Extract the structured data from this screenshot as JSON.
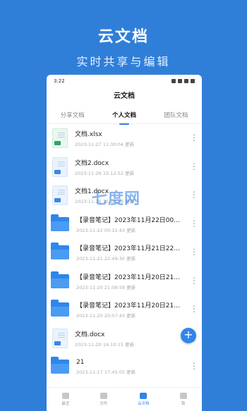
{
  "hero": {
    "title": "云文档",
    "subtitle": "实时共享与编辑"
  },
  "statusbar": {
    "time": "3:22"
  },
  "app": {
    "title": "云文档"
  },
  "tabs": [
    {
      "label": "分享文档",
      "active": false
    },
    {
      "label": "个人文档",
      "active": true
    },
    {
      "label": "团队文档",
      "active": false
    }
  ],
  "files": [
    {
      "type": "sheet",
      "name": "文档.xlsx",
      "date": "2023-11-27 11:30:04 更新"
    },
    {
      "type": "doc",
      "name": "文档2.docx",
      "date": "2023-11-26 15:12:52 更新"
    },
    {
      "type": "doc",
      "name": "文档1.docx",
      "date": "2023-11-26 15:12:29 更新"
    },
    {
      "type": "folder",
      "name": "【录音笔记】2023年11月22日00...",
      "date": "2023-11-22 00:11:43 更新"
    },
    {
      "type": "folder",
      "name": "【录音笔记】2023年11月21日22...",
      "date": "2023-11-21 22:49:30 更新"
    },
    {
      "type": "folder",
      "name": "【录音笔记】2023年11月20日21...",
      "date": "2023-11-20 21:08:59 更新"
    },
    {
      "type": "folder",
      "name": "【录音笔记】2023年11月20日21...",
      "date": "2023-11-20 20:07:43 更新"
    },
    {
      "type": "doc",
      "name": "文档.docx",
      "date": "2023-11-20 16:10:15 更新"
    },
    {
      "type": "folder",
      "name": "21",
      "date": "2023-11-17 17:45:05 更新"
    }
  ],
  "fab": {
    "label": "+"
  },
  "nav": [
    {
      "label": "最近",
      "active": false,
      "icon": "recent-icon"
    },
    {
      "label": "文件",
      "active": false,
      "icon": "file-icon"
    },
    {
      "label": "云文档",
      "active": true,
      "icon": "cloud-icon"
    },
    {
      "label": "我",
      "active": false,
      "icon": "user-icon"
    }
  ],
  "watermark": "七度网",
  "colors": {
    "accent": "#2f86ea",
    "background": "#2f7fd9"
  }
}
